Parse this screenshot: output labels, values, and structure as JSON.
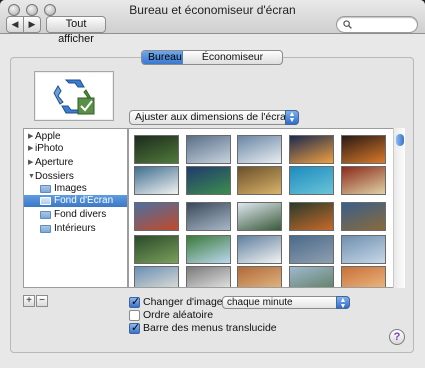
{
  "window": {
    "title": "Bureau et économiseur d'écran"
  },
  "toolbar": {
    "show_all_label": "Tout afficher",
    "back_glyph": "◀",
    "forward_glyph": "▶"
  },
  "tabs": [
    {
      "label": "Bureau",
      "selected": true
    },
    {
      "label": "Économiseur d'écran",
      "selected": false
    }
  ],
  "fit_popup": {
    "value": "Ajuster aux dimensions de l'écran"
  },
  "sources": [
    {
      "label": "Apple",
      "kind": "group",
      "expanded": false
    },
    {
      "label": "iPhoto",
      "kind": "group",
      "expanded": false
    },
    {
      "label": "Aperture",
      "kind": "group",
      "expanded": false
    },
    {
      "label": "Dossiers",
      "kind": "group",
      "expanded": true
    },
    {
      "label": "Images",
      "kind": "folder"
    },
    {
      "label": "Fond d'Écran",
      "kind": "folder",
      "selected": true
    },
    {
      "label": "Fond divers",
      "kind": "folder"
    },
    {
      "label": "Intérieurs",
      "kind": "folder"
    }
  ],
  "list_buttons": {
    "add": "+",
    "remove": "−"
  },
  "options": {
    "change_picture": {
      "label": "Changer d'image :",
      "checked": true
    },
    "interval": {
      "value": "chaque minute"
    },
    "random_order": {
      "label": "Ordre aléatoire",
      "checked": false
    },
    "translucent_menu": {
      "label": "Barre des menus translucide",
      "checked": true
    }
  },
  "help": {
    "label": "?"
  },
  "thumbnails": [
    {
      "colors": [
        "#1d2b1d",
        "#4f7a3a"
      ]
    },
    {
      "colors": [
        "#5a6f87",
        "#c7d3df"
      ]
    },
    {
      "colors": [
        "#6a86a4",
        "#e8eef2"
      ]
    },
    {
      "colors": [
        "#1c2a4f",
        "#f0a040"
      ]
    },
    {
      "colors": [
        "#2a1a14",
        "#d97a2a"
      ]
    },
    {
      "colors": [
        "#3f6f8f",
        "#f2f2f2"
      ]
    },
    {
      "colors": [
        "#203a6b",
        "#3c8e4f"
      ]
    },
    {
      "colors": [
        "#6b4f2a",
        "#d9b46a"
      ]
    },
    {
      "colors": [
        "#1d8bbf",
        "#6ac4d8"
      ]
    },
    {
      "colors": [
        "#8a2a1a",
        "#e0d2a6"
      ]
    },
    {
      "colors": [
        "#4d6fa0",
        "#c24a2a"
      ]
    },
    {
      "colors": [
        "#3a4a5a",
        "#a8b8c8"
      ]
    },
    {
      "colors": [
        "#dfe7ef",
        "#3a5a3a"
      ]
    },
    {
      "colors": [
        "#2a3a2a",
        "#c86a2a"
      ]
    },
    {
      "colors": [
        "#3a5f8a",
        "#8a6a3a"
      ]
    },
    {
      "colors": [
        "#2a4a2a",
        "#7aa05a"
      ]
    },
    {
      "colors": [
        "#3a7a3a",
        "#bcd8ee"
      ]
    },
    {
      "colors": [
        "#5f7f9f",
        "#f4f4f4"
      ]
    },
    {
      "colors": [
        "#4a6a8a",
        "#8f9fb0"
      ]
    },
    {
      "colors": [
        "#6f8faf",
        "#c8d8e8"
      ]
    },
    {
      "colors": [
        "#6a8fb5",
        "#ede7d8"
      ]
    },
    {
      "colors": [
        "#7a7a7a",
        "#f2f2f2"
      ]
    },
    {
      "colors": [
        "#b06a3a",
        "#e8c08a"
      ]
    },
    {
      "colors": [
        "#9fb8cf",
        "#5a7a5a"
      ]
    },
    {
      "colors": [
        "#c8703a",
        "#f0c088"
      ]
    }
  ]
}
